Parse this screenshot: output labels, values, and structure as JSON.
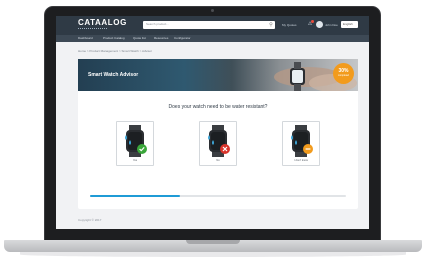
{
  "app": {
    "logo_text": "CATAALOG",
    "search_placeholder": "Search product...",
    "header_links": [
      "My Quotes",
      "John Doe",
      "English"
    ],
    "brand_color": "#2f3a45",
    "accent_color": "#1f9bd6"
  },
  "subnav": {
    "items": [
      "Dashboard",
      "Product Catalog",
      "Quote list",
      "Resources",
      "Configurator"
    ]
  },
  "breadcrumb": "Home > Product Management > Smart Watch > Advisor",
  "advisor": {
    "title": "Smart Watch Advisor",
    "badge_percent": "30%",
    "badge_label": "completed",
    "question": "Does your watch need to be water resistant?",
    "options": [
      {
        "label": "Yes",
        "status_color": "#3aa63a",
        "status_icon": "check-icon"
      },
      {
        "label": "No",
        "status_color": "#d9342b",
        "status_icon": "cross-icon"
      },
      {
        "label": "I don't know",
        "status_color": "#f29b1d",
        "status_icon": "minus-icon"
      }
    ],
    "progress": 0.35
  },
  "footer": {
    "copyright": "Copyright © 2017"
  }
}
